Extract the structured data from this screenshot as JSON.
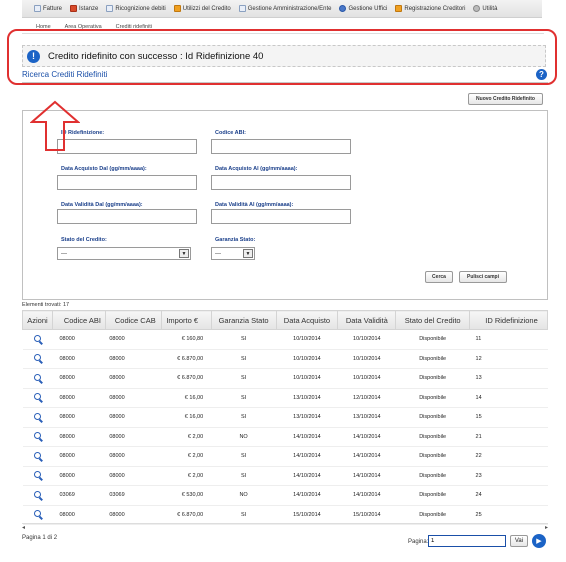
{
  "nav": {
    "items": [
      {
        "label": "Fatture",
        "icon": "document-icon"
      },
      {
        "label": "Istanze",
        "icon": "pdf-icon"
      },
      {
        "label": "Ricognizione debiti",
        "icon": "document-icon"
      },
      {
        "label": "Utilizzi del Credito",
        "icon": "person-icon"
      },
      {
        "label": "Gestione Amministrazione/Ente",
        "icon": "building-icon"
      },
      {
        "label": "Gestione Uffici",
        "icon": "network-icon"
      },
      {
        "label": "Registrazione Creditori",
        "icon": "person-icon"
      },
      {
        "label": "Utilità",
        "icon": "settings-icon"
      }
    ]
  },
  "breadcrumb": [
    "Home",
    "Area Operativa",
    "Crediti ridefiniti"
  ],
  "message": {
    "text": "Credito ridefinito con successo : Id Ridefinizione 40"
  },
  "section_title": "Ricerca Crediti Ridefiniti",
  "new_button": "Nuovo Credito Ridefinito",
  "form": {
    "id_label": "ID Ridefinizione:",
    "abi_label": "Codice ABI:",
    "acq_dal_label": "Data Acquisto Dal (gg/mm/aaaa):",
    "acq_al_label": "Data Acquisto Al (gg/mm/aaaa):",
    "val_dal_label": "Data Validità Dal (gg/mm/aaaa):",
    "val_al_label": "Data Validità Al (gg/mm/aaaa):",
    "stato_label": "Stato del Credito:",
    "garanzia_label": "Garanzia Stato:",
    "stato_value": "---",
    "garanzia_value": "---",
    "cerca": "Cerca",
    "pulisci": "Pulisci campi"
  },
  "found": "Elementi trovati: 17",
  "table": {
    "headers": [
      "Azioni",
      "Codice ABI",
      "Codice CAB",
      "Importo €",
      "Garanzia Stato",
      "Data Acquisto",
      "Data Validità",
      "Stato del Credito",
      "ID Ridefinizione"
    ],
    "rows": [
      {
        "abi": "08000",
        "cab": "08000",
        "importo": "€ 160,80",
        "gar": "SI",
        "acq": "10/10/2014",
        "val": "10/10/2014",
        "stato": "Disponibile",
        "id": "11"
      },
      {
        "abi": "08000",
        "cab": "08000",
        "importo": "€ 6.870,00",
        "gar": "SI",
        "acq": "10/10/2014",
        "val": "10/10/2014",
        "stato": "Disponibile",
        "id": "12"
      },
      {
        "abi": "08000",
        "cab": "08000",
        "importo": "€ 6.870,00",
        "gar": "SI",
        "acq": "10/10/2014",
        "val": "10/10/2014",
        "stato": "Disponibile",
        "id": "13"
      },
      {
        "abi": "08000",
        "cab": "08000",
        "importo": "€ 16,00",
        "gar": "SI",
        "acq": "13/10/2014",
        "val": "12/10/2014",
        "stato": "Disponibile",
        "id": "14"
      },
      {
        "abi": "08000",
        "cab": "08000",
        "importo": "€ 16,00",
        "gar": "SI",
        "acq": "13/10/2014",
        "val": "13/10/2014",
        "stato": "Disponibile",
        "id": "15"
      },
      {
        "abi": "08000",
        "cab": "08000",
        "importo": "€ 2,00",
        "gar": "NO",
        "acq": "14/10/2014",
        "val": "14/10/2014",
        "stato": "Disponibile",
        "id": "21"
      },
      {
        "abi": "08000",
        "cab": "08000",
        "importo": "€ 2,00",
        "gar": "SI",
        "acq": "14/10/2014",
        "val": "14/10/2014",
        "stato": "Disponibile",
        "id": "22"
      },
      {
        "abi": "08000",
        "cab": "08000",
        "importo": "€ 2,00",
        "gar": "SI",
        "acq": "14/10/2014",
        "val": "14/10/2014",
        "stato": "Disponibile",
        "id": "23"
      },
      {
        "abi": "03069",
        "cab": "03069",
        "importo": "€ 530,00",
        "gar": "NO",
        "acq": "14/10/2014",
        "val": "14/10/2014",
        "stato": "Disponibile",
        "id": "24"
      },
      {
        "abi": "08000",
        "cab": "08000",
        "importo": "€ 6.870,00",
        "gar": "SI",
        "acq": "15/10/2014",
        "val": "15/10/2014",
        "stato": "Disponibile",
        "id": "25"
      }
    ]
  },
  "pagination": {
    "info": "Pagina 1 di 2",
    "label": "Pagina:",
    "value": "1",
    "go": "Vai"
  },
  "colors": {
    "accent": "#1b63c6",
    "highlight": "#e03030"
  }
}
